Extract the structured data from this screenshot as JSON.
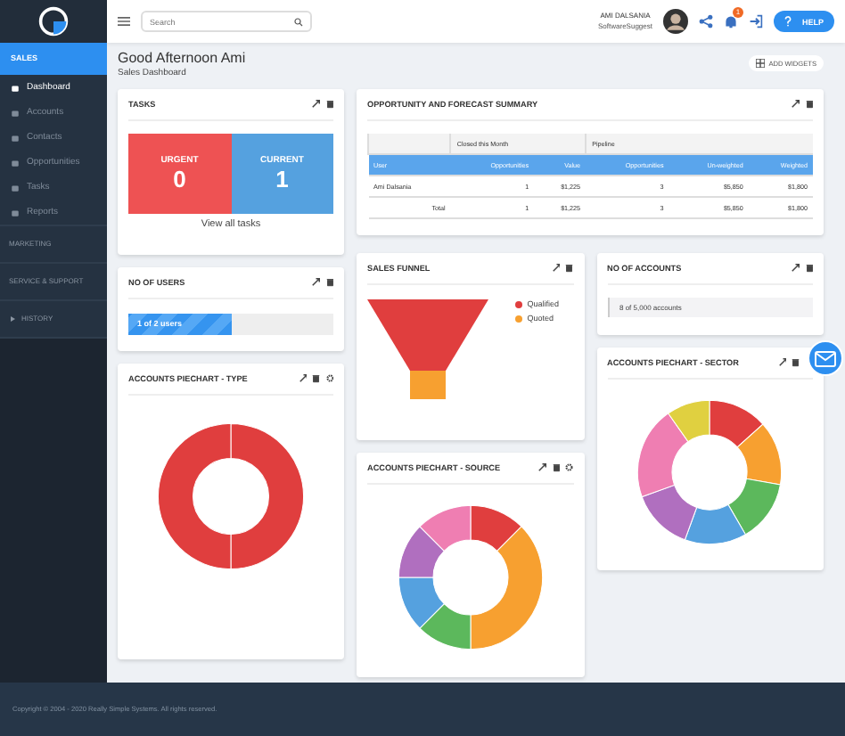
{
  "sidebar": {
    "section": "SALES",
    "items": [
      {
        "label": "Dashboard",
        "selected": true
      },
      {
        "label": "Accounts",
        "selected": false
      },
      {
        "label": "Contacts",
        "selected": false
      },
      {
        "label": "Opportunities",
        "selected": false
      },
      {
        "label": "Tasks",
        "selected": false
      },
      {
        "label": "Reports",
        "selected": false
      }
    ],
    "groups": [
      "MARKETING",
      "SERVICE & SUPPORT"
    ],
    "history": "HISTORY"
  },
  "header": {
    "search": {
      "placeholder": "Search"
    },
    "user": {
      "name": "AMI DALSANIA",
      "company": "SoftwareSuggest"
    },
    "notifications": "1",
    "help": "HELP"
  },
  "greeting": "Good Afternoon Ami",
  "subtitle": "Sales Dashboard",
  "add_widgets": "ADD WIDGETS",
  "tasks": {
    "title": "TASKS",
    "tiles": [
      {
        "label": "URGENT",
        "count": "0",
        "color": "#ee5253"
      },
      {
        "label": "CURRENT",
        "count": "1",
        "color": "#55a1df"
      }
    ],
    "link": "View all tasks"
  },
  "opportunity": {
    "title": "OPPORTUNITY AND FORECAST SUMMARY",
    "groups": [
      "Closed this Month",
      "Pipeline"
    ],
    "columns": [
      "User",
      "Opportunities",
      "Value",
      "Opportunities",
      "Un-weighted",
      "Weighted"
    ],
    "rows": [
      [
        "Ami Dalsania",
        "1",
        "$1,225",
        "3",
        "$5,850",
        "$1,800"
      ],
      [
        "Total",
        "1",
        "$1,225",
        "3",
        "$5,850",
        "$1,800"
      ]
    ]
  },
  "users": {
    "title": "NO OF USERS",
    "bar": "1 of 2 users",
    "level": 0.5
  },
  "funnel": {
    "title": "SALES FUNNEL",
    "legend": [
      {
        "label": "Qualified",
        "color": "#e03e3e"
      },
      {
        "label": "Quoted",
        "color": "#f7a030"
      }
    ]
  },
  "accounts": {
    "title": "NO OF ACCOUNTS",
    "value": "8 of 5,000 accounts"
  },
  "pies": [
    {
      "title": "ACCOUNTS PIECHART - TYPE",
      "kind": "type"
    },
    {
      "title": "ACCOUNTS PIECHART - SOURCE",
      "kind": "source"
    },
    {
      "title": "ACCOUNTS PIECHART - SECTOR",
      "kind": "sector"
    }
  ],
  "footer": "Copyright © 2004 - 2020 Really Simple Systems. All rights reserved."
}
